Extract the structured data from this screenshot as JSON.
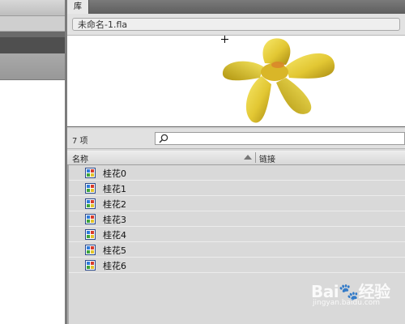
{
  "library": {
    "tab_label": "库",
    "document_name": "未命名-1.fla",
    "item_count": "7 项",
    "search_value": "",
    "columns": {
      "name": "名称",
      "linkage": "链接"
    },
    "items": [
      {
        "label": "桂花0",
        "icon": "bitmap-icon"
      },
      {
        "label": "桂花1",
        "icon": "bitmap-icon"
      },
      {
        "label": "桂花2",
        "icon": "bitmap-icon"
      },
      {
        "label": "桂花3",
        "icon": "bitmap-icon"
      },
      {
        "label": "桂花4",
        "icon": "bitmap-icon"
      },
      {
        "label": "桂花5",
        "icon": "bitmap-icon"
      },
      {
        "label": "桂花6",
        "icon": "bitmap-icon"
      }
    ]
  },
  "watermark": {
    "brand": "Bai",
    "brand_cn": "经验",
    "url": "jingyan.baidu.com"
  },
  "colors": {
    "flower_light": "#f4e25a",
    "flower_dark": "#b89a16",
    "flower_center": "#d9852a"
  }
}
